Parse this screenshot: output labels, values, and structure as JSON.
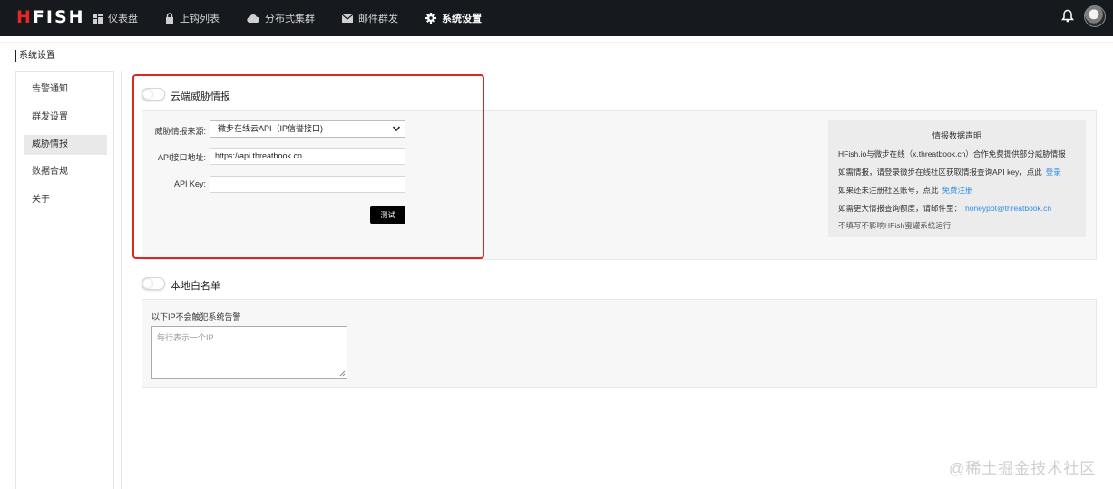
{
  "topbar": {
    "logo": {
      "h": "H",
      "rest": "FISH"
    },
    "nav": [
      {
        "label": "仪表盘",
        "icon": "dashboard-icon"
      },
      {
        "label": "上钩列表",
        "icon": "lock-icon"
      },
      {
        "label": "分布式集群",
        "icon": "cloud-icon"
      },
      {
        "label": "邮件群发",
        "icon": "mail-icon"
      },
      {
        "label": "系统设置",
        "icon": "gear-icon",
        "active": true
      }
    ]
  },
  "page": {
    "title": "系统设置"
  },
  "sidebar": {
    "items": [
      {
        "label": "告警通知"
      },
      {
        "label": "群发设置"
      },
      {
        "label": "威胁情报",
        "active": true
      },
      {
        "label": "数据合规"
      },
      {
        "label": "关于"
      }
    ]
  },
  "cloud_intel": {
    "title": "云端威胁情报",
    "source_label": "威胁情报来源:",
    "source_value": "微步在线云API（IP信誉接口)",
    "api_url_label": "API接口地址:",
    "api_url_value": "https://api.threatbook.cn",
    "api_key_label": "API Key:",
    "api_key_value": "",
    "test_button": "测试"
  },
  "notice": {
    "title": "情报数据声明",
    "line1": "HFish.io与微步在线（x.threatbook.cn）合作免费提供部分威胁情报",
    "line2": "如需情报，请登录微步在线社区获取情报查询API key，点此",
    "line2_link": "登录",
    "line3": "如果还未注册社区账号，点此",
    "line3_link": "免费注册",
    "line4": "如需更大情报查询额度，请邮件至：",
    "line4_link": "honeypot@threatbook.cn",
    "line5": "不填写不影响HFish蜜罐系统运行"
  },
  "whitelist": {
    "title": "本地白名单",
    "label": "以下IP不会触犯系统告警",
    "placeholder": "每行表示一个IP"
  },
  "watermark": "@稀土掘金技术社区",
  "colors": {
    "topbar": "#16191d",
    "highlight": "#e02424",
    "link": "#2e8ce8",
    "logo_accent": "#e5262b"
  }
}
